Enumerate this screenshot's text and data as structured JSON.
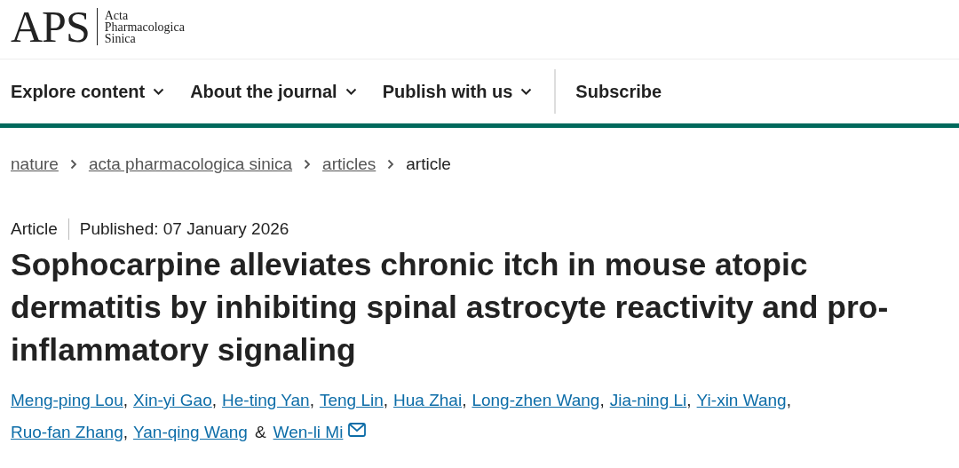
{
  "logo": {
    "mark": "APS",
    "name_lines": [
      "Acta",
      "Pharmacologica",
      "Sinica"
    ]
  },
  "nav": [
    {
      "label": "Explore content",
      "dropdown": true
    },
    {
      "label": "About the journal",
      "dropdown": true
    },
    {
      "label": "Publish with us",
      "dropdown": true
    },
    {
      "label": "Subscribe",
      "dropdown": false
    }
  ],
  "breadcrumbs": [
    {
      "label": "nature",
      "link": true
    },
    {
      "label": "acta pharmacologica sinica",
      "link": true
    },
    {
      "label": "articles",
      "link": true
    },
    {
      "label": "article",
      "link": false
    }
  ],
  "article": {
    "type": "Article",
    "published": "Published: 07 January 2026",
    "title": "Sophocarpine alleviates chronic itch in mouse atopic dermatitis by inhibiting spinal astrocyte reactivity and pro-inflammatory signaling",
    "author_lines": [
      [
        {
          "name": "Meng-ping Lou",
          "after": ","
        },
        {
          "name": "Xin-yi Gao",
          "after": ","
        },
        {
          "name": "He-ting Yan",
          "after": ","
        },
        {
          "name": "Teng Lin",
          "after": ","
        },
        {
          "name": "Hua Zhai",
          "after": ","
        },
        {
          "name": "Long-zhen Wang",
          "after": ","
        },
        {
          "name": "Jia-ning Li",
          "after": ","
        },
        {
          "name": "Yi-xin Wang",
          "after": ","
        }
      ],
      [
        {
          "name": "Ruo-fan Zhang",
          "after": ","
        },
        {
          "name": "Yan-qing Wang",
          "after": "&"
        },
        {
          "name": "Wen-li Mi",
          "email": true
        }
      ]
    ]
  }
}
